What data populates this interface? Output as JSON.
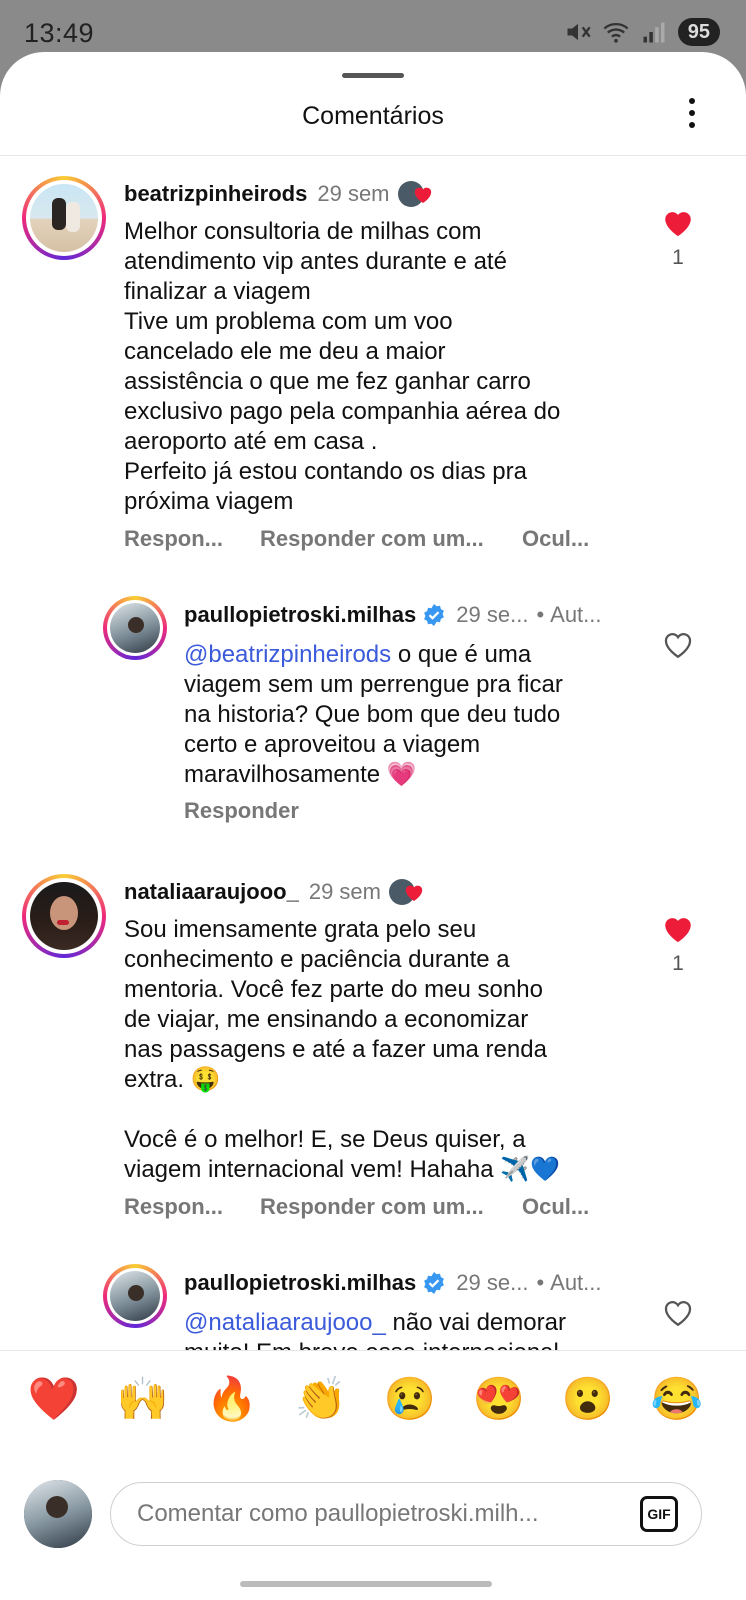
{
  "status_bar": {
    "time": "13:49",
    "battery": "95"
  },
  "sheet": {
    "title": "Comentários"
  },
  "comments": [
    {
      "username": "beatrizpinheirods",
      "time": "29 sem",
      "lines": [
        "Melhor consultoria de milhas com",
        "atendimento vip antes durante e até",
        "finalizar a viagem",
        "Tive um problema com um voo",
        "cancelado ele me deu a maior",
        "assistência o que me fez ganhar carro",
        "exclusivo pago pela companhia aérea do",
        "aeroporto até em casa .",
        "Perfeito já estou contando os dias pra",
        "próxima viagem"
      ],
      "actions": [
        "Respon...",
        "Responder com um...",
        "Ocul..."
      ],
      "like_count": "1",
      "liked": true
    },
    {
      "username": "paullopietroski.milhas",
      "time": "29 se...",
      "author": "Aut...",
      "mention": "@beatrizpinheirods",
      "lines": [
        "o que é uma",
        "viagem sem um perrengue pra ficar",
        "na historia? Que bom que deu tudo",
        "certo e aproveitou a viagem",
        "maravilhosamente 💗"
      ],
      "actions": [
        "Responder"
      ],
      "liked": false
    },
    {
      "username": "nataliaaraujooo_",
      "time": "29 sem",
      "lines": [
        "Sou imensamente grata pelo seu",
        "conhecimento e paciência durante a",
        "mentoria. Você fez parte do meu sonho",
        "de viajar, me ensinando a economizar",
        "nas passagens e até a fazer uma renda",
        "extra. 🤑",
        "",
        "Você é o melhor! E, se Deus quiser, a",
        "viagem internacional vem! Hahaha ✈️💙"
      ],
      "actions": [
        "Respon...",
        "Responder com um...",
        "Ocul..."
      ],
      "like_count": "1",
      "liked": true
    },
    {
      "username": "paullopietroski.milhas",
      "time": "29 se...",
      "author": "Aut...",
      "mention": "@nataliaaraujooo_",
      "lines": [
        "não vai demorar",
        "muito! Em breve essa internacional"
      ],
      "liked": false
    }
  ],
  "emoji_bar": [
    "❤️",
    "🙌",
    "🔥",
    "👏",
    "😢",
    "😍",
    "😮",
    "😂"
  ],
  "compose": {
    "placeholder": "Comentar como paullopietroski.milh...",
    "gif_label": "GIF"
  },
  "colors": {
    "like_red": "#ed1d3a",
    "mention_blue": "#3b5bdb",
    "muted_gray": "#777777"
  }
}
